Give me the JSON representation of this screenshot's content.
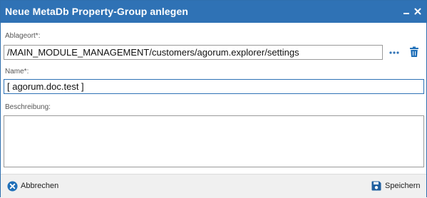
{
  "dialog": {
    "title": "Neue MetaDb Property-Group anlegen"
  },
  "form": {
    "location_label": "Ablageort*:",
    "location_value": "/MAIN_MODULE_MANAGEMENT/customers/agorum.explorer/settings",
    "name_label": "Name*:",
    "name_value": "[ agorum.doc.test ]",
    "description_label": "Beschreibung:",
    "description_value": ""
  },
  "footer": {
    "cancel_label": "Abbrechen",
    "save_label": "Speichern"
  },
  "colors": {
    "accent": "#2f72b5",
    "titlebar": "#2f72b5",
    "delete_icon": "#1f6fb8",
    "cancel_icon": "#1f6fb8"
  },
  "icons": [
    "minimize-icon",
    "close-icon",
    "more-options-icon",
    "trash-icon",
    "cancel-icon",
    "save-icon"
  ]
}
